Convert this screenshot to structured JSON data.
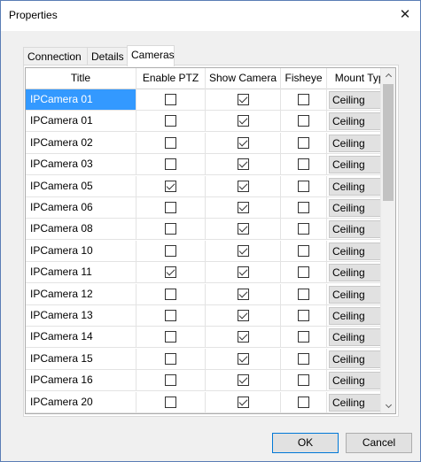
{
  "window": {
    "title": "Properties",
    "close_glyph": "✕"
  },
  "tabs": [
    {
      "label": "Connection"
    },
    {
      "label": "Details"
    },
    {
      "label": "Cameras",
      "active": true
    }
  ],
  "grid": {
    "columns": [
      "Title",
      "Enable PTZ",
      "Show Camera",
      "Fisheye",
      "Mount Type"
    ],
    "rows": [
      {
        "title": "IPCamera 01",
        "ptz": false,
        "show": true,
        "fisheye": false,
        "mount": "Ceiling",
        "selected": true
      },
      {
        "title": "IPCamera 01",
        "ptz": false,
        "show": true,
        "fisheye": false,
        "mount": "Ceiling"
      },
      {
        "title": "IPCamera 02",
        "ptz": false,
        "show": true,
        "fisheye": false,
        "mount": "Ceiling"
      },
      {
        "title": "IPCamera 03",
        "ptz": false,
        "show": true,
        "fisheye": false,
        "mount": "Ceiling"
      },
      {
        "title": "IPCamera 05",
        "ptz": true,
        "show": true,
        "fisheye": false,
        "mount": "Ceiling"
      },
      {
        "title": "IPCamera 06",
        "ptz": false,
        "show": true,
        "fisheye": false,
        "mount": "Ceiling"
      },
      {
        "title": "IPCamera 08",
        "ptz": false,
        "show": true,
        "fisheye": false,
        "mount": "Ceiling"
      },
      {
        "title": "IPCamera 10",
        "ptz": false,
        "show": true,
        "fisheye": false,
        "mount": "Ceiling"
      },
      {
        "title": "IPCamera 11",
        "ptz": true,
        "show": true,
        "fisheye": false,
        "mount": "Ceiling"
      },
      {
        "title": "IPCamera 12",
        "ptz": false,
        "show": true,
        "fisheye": false,
        "mount": "Ceiling"
      },
      {
        "title": "IPCamera 13",
        "ptz": false,
        "show": true,
        "fisheye": false,
        "mount": "Ceiling"
      },
      {
        "title": "IPCamera 14",
        "ptz": false,
        "show": true,
        "fisheye": false,
        "mount": "Ceiling"
      },
      {
        "title": "IPCamera 15",
        "ptz": false,
        "show": true,
        "fisheye": false,
        "mount": "Ceiling"
      },
      {
        "title": "IPCamera 16",
        "ptz": false,
        "show": true,
        "fisheye": false,
        "mount": "Ceiling"
      },
      {
        "title": "IPCamera 20",
        "ptz": false,
        "show": true,
        "fisheye": false,
        "mount": "Ceiling"
      }
    ]
  },
  "buttons": {
    "ok": "OK",
    "cancel": "Cancel"
  },
  "colors": {
    "selection": "#3399ff",
    "window_border": "#5a7db5",
    "default_button_border": "#0078d7"
  },
  "icons": {
    "close": "close-icon",
    "scroll_up": "chevron-up-icon",
    "scroll_down": "chevron-down-icon",
    "dropdown": "chevron-down-icon"
  }
}
